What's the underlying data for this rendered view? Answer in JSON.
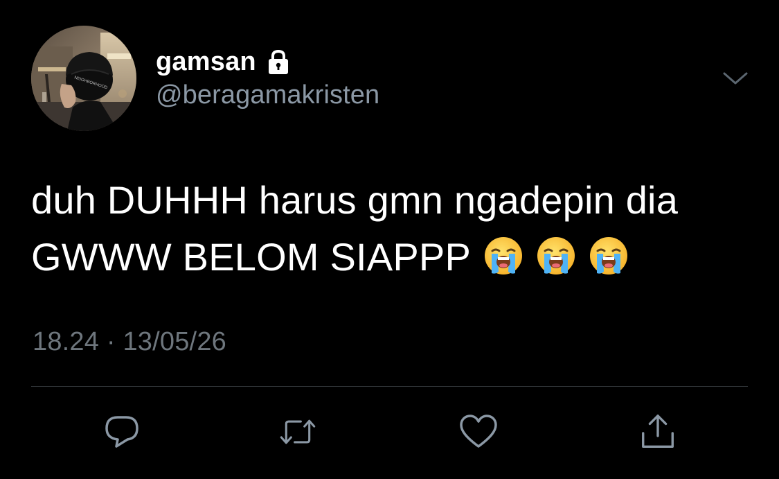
{
  "tweet": {
    "author": {
      "display_name": "gamsan",
      "handle": "@beragamakristen",
      "protected_icon": "lock-icon",
      "avatar": "profile-photo"
    },
    "text_lines": [
      "duh DUHHH harus gmn ngadepin dia",
      "GWWW BELOM SIAPPP"
    ],
    "emojis": [
      "😭",
      "😭",
      "😭"
    ],
    "timestamp": "18.24 · 13/05/26",
    "menu_icon": "chevron-down-icon"
  },
  "actions": [
    {
      "name": "reply",
      "icon": "reply-icon"
    },
    {
      "name": "retweet",
      "icon": "retweet-icon"
    },
    {
      "name": "like",
      "icon": "heart-icon"
    },
    {
      "name": "share",
      "icon": "share-icon"
    }
  ],
  "colors": {
    "background": "#000000",
    "primary_text": "#ffffff",
    "secondary_text": "#8b98a5",
    "timestamp_text": "#6e767d",
    "divider": "#2f3336",
    "icon": "#8b98a5"
  }
}
